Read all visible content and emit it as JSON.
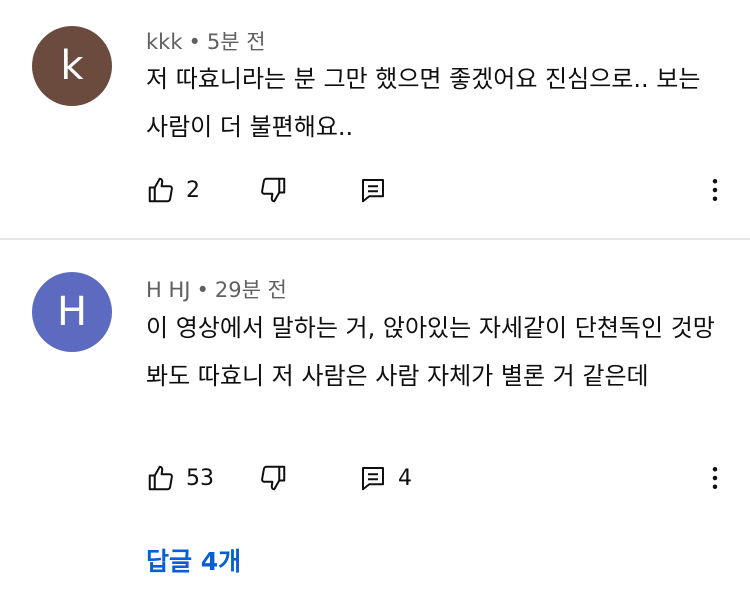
{
  "comments": [
    {
      "avatar_letter": "k",
      "avatar_color": "#6b4b3e",
      "author": "kkk",
      "time": "5분 전",
      "text": "저 따효니라는 분 그만 했으면 좋겠어요 진심으로.. 보는 사람이 더 불편해요..",
      "likes": "2",
      "replies_count": ""
    },
    {
      "avatar_letter": "H",
      "avatar_color": "#5c6bc0",
      "author": "H HJ",
      "time": "29분 전",
      "text": "이 영상에서 말하는 거, 앉아있는 자세같이 단쳔독인 것망 봐도 따효니 저 사람은 사람 자체가 별론 거 같은데",
      "likes": "53",
      "replies_count": "4",
      "replies_link": "답글 4개"
    }
  ],
  "icons": {
    "like": "thumb-up-icon",
    "dislike": "thumb-down-icon",
    "reply": "comment-icon",
    "more": "more-vert-icon"
  },
  "colors": {
    "link": "#065fd4",
    "meta": "#606060"
  }
}
